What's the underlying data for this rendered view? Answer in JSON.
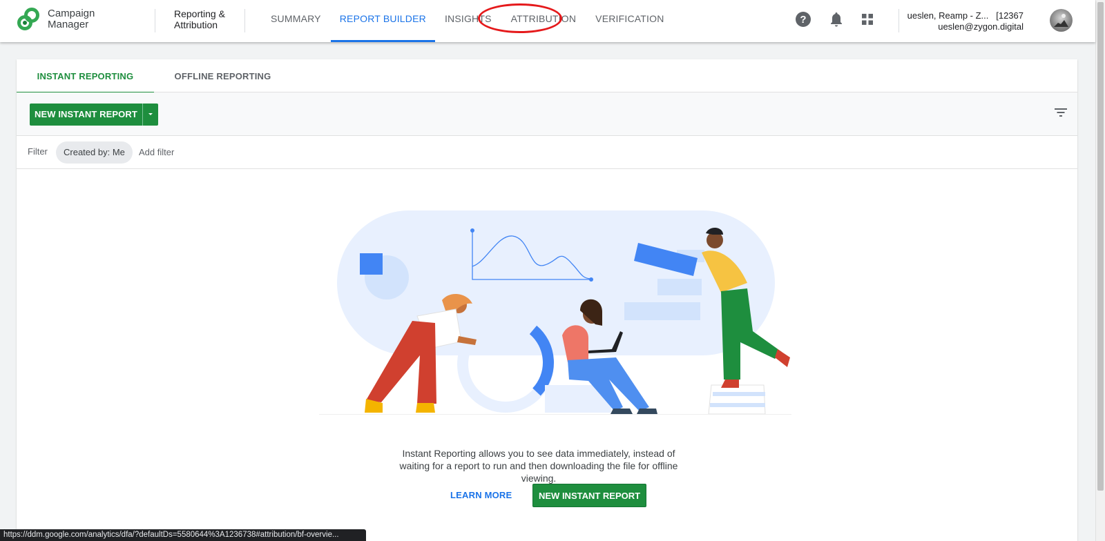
{
  "app": {
    "product_name": "Campaign Manager",
    "section_name": "Reporting & Attribution"
  },
  "nav": {
    "tabs": [
      {
        "label": "SUMMARY",
        "active": false
      },
      {
        "label": "REPORT BUILDER",
        "active": true
      },
      {
        "label": "INSIGHTS",
        "active": false
      },
      {
        "label": "ATTRIBUTION",
        "active": false,
        "annotated": true
      },
      {
        "label": "VERIFICATION",
        "active": false
      }
    ]
  },
  "header_icons": [
    "help-icon",
    "notifications-icon",
    "apps-grid-icon"
  ],
  "account": {
    "name": "ueslen, Reamp - Z...",
    "id": "[12367",
    "email": "ueslen@zygon.digital"
  },
  "subtabs": [
    {
      "label": "INSTANT REPORTING",
      "active": true
    },
    {
      "label": "OFFLINE REPORTING",
      "active": false
    }
  ],
  "toolbar": {
    "new_report_label": "NEW INSTANT REPORT"
  },
  "filters": {
    "label": "Filter",
    "chip": "Created by: Me",
    "add_label": "Add filter"
  },
  "empty_state": {
    "message": "Instant Reporting allows you to see data immediately, instead of waiting for a report to run and then downloading the file for offline viewing.",
    "learn_more_label": "LEARN MORE",
    "cta_label": "NEW INSTANT REPORT"
  },
  "status_bar": {
    "url": "https://ddm.google.com/analytics/dfa/?defaultDs=5580644%3A1236738#attribution/bf-overvie..."
  },
  "colors": {
    "primary_blue": "#1a73e8",
    "action_green": "#1e8e3e",
    "annotation_red": "#e5191b"
  }
}
